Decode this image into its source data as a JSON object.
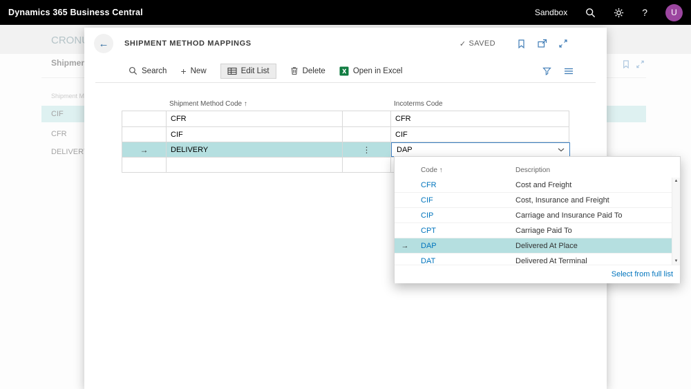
{
  "topbar": {
    "app_title": "Dynamics 365 Business Central",
    "environment": "Sandbox",
    "help_label": "?",
    "avatar_initial": "U"
  },
  "background_page": {
    "company": "CRONUS",
    "page_title": "Shipment M",
    "column_header": "Shipment M",
    "rows": [
      "CIF",
      "CFR",
      "DELIVERY"
    ],
    "selected_row": "CIF"
  },
  "panel": {
    "title": "SHIPMENT METHOD MAPPINGS",
    "saved_check": "✓",
    "saved_status": "SAVED",
    "back_arrow": "←",
    "toolbar": {
      "search_label": "Search",
      "new_label": "New",
      "plus_glyph": "+",
      "edit_list_label": "Edit List",
      "delete_label": "Delete",
      "open_in_excel_label": "Open in Excel"
    },
    "table": {
      "col_shipment_method": "Shipment Method Code ↑",
      "col_incoterms": "Incoterms Code",
      "row_arrow": "→",
      "ellipsis": "⋮",
      "rows": [
        {
          "shipment_method_code": "CFR",
          "incoterms_code": "CFR"
        },
        {
          "shipment_method_code": "CIF",
          "incoterms_code": "CIF"
        },
        {
          "shipment_method_code": "DELIVERY",
          "incoterms_code": "DAP"
        }
      ],
      "selected_row_index": 2,
      "combobox_value": "DAP"
    }
  },
  "dropdown": {
    "col_code": "Code ↑",
    "col_description": "Description",
    "row_arrow": "→",
    "options": [
      {
        "code": "CFR",
        "description": "Cost and Freight"
      },
      {
        "code": "CIF",
        "description": "Cost, Insurance and Freight"
      },
      {
        "code": "CIP",
        "description": "Carriage and Insurance Paid To"
      },
      {
        "code": "CPT",
        "description": "Carriage Paid To"
      },
      {
        "code": "DAP",
        "description": "Delivered At Place"
      },
      {
        "code": "DAT",
        "description": "Delivered At Terminal"
      }
    ],
    "selected_code": "DAP",
    "footer_link": "Select from full list"
  },
  "colors": {
    "selection_teal": "#b5dfe0",
    "link_blue": "#0074bd",
    "excel_green": "#107c41",
    "avatar_purple": "#9c46a0",
    "combobox_border": "#3e82c4",
    "topbar_black": "#000000"
  }
}
